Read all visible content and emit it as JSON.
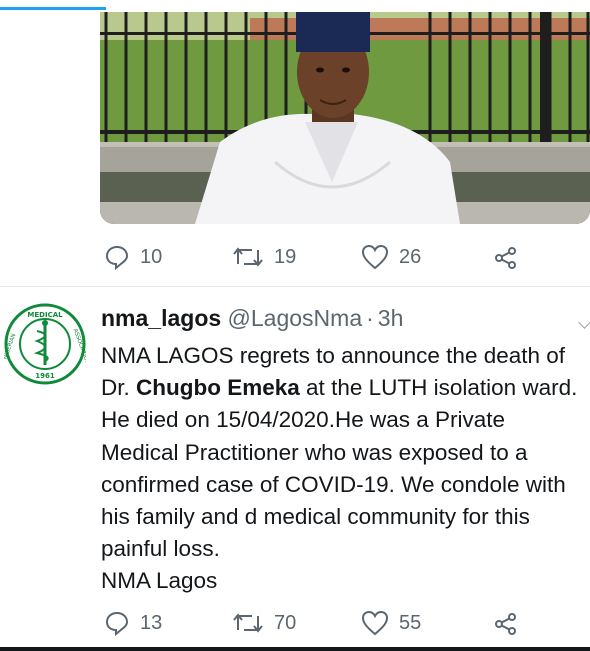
{
  "tweet1": {
    "replies": "10",
    "retweets": "19",
    "likes": "26"
  },
  "tweet2": {
    "display_name": "nma_lagos",
    "handle": "@LagosNma",
    "separator": "·",
    "time": "3h",
    "text_p1": "NMA LAGOS regrets to announce the death of Dr. ",
    "text_bold": "Chugbo Emeka",
    "text_p2": " at the LUTH isolation ward. He died on 15/04/2020.He was a Private Medical Practitioner who was exposed to a confirmed case of COVID-19. We condole with his family and d medical community for this painful loss.",
    "signature": "NMA Lagos",
    "replies": "13",
    "retweets": "70",
    "likes": "55"
  },
  "avatar_seal": {
    "top_text": "MEDICAL",
    "left_text": "NIGERIAN",
    "right_text": "ASSOCIATION",
    "year": "1961"
  },
  "colors": {
    "accent": "#1da1f2",
    "text": "#14171a",
    "muted": "#5b6670",
    "seal_green": "#0f8a3a"
  }
}
